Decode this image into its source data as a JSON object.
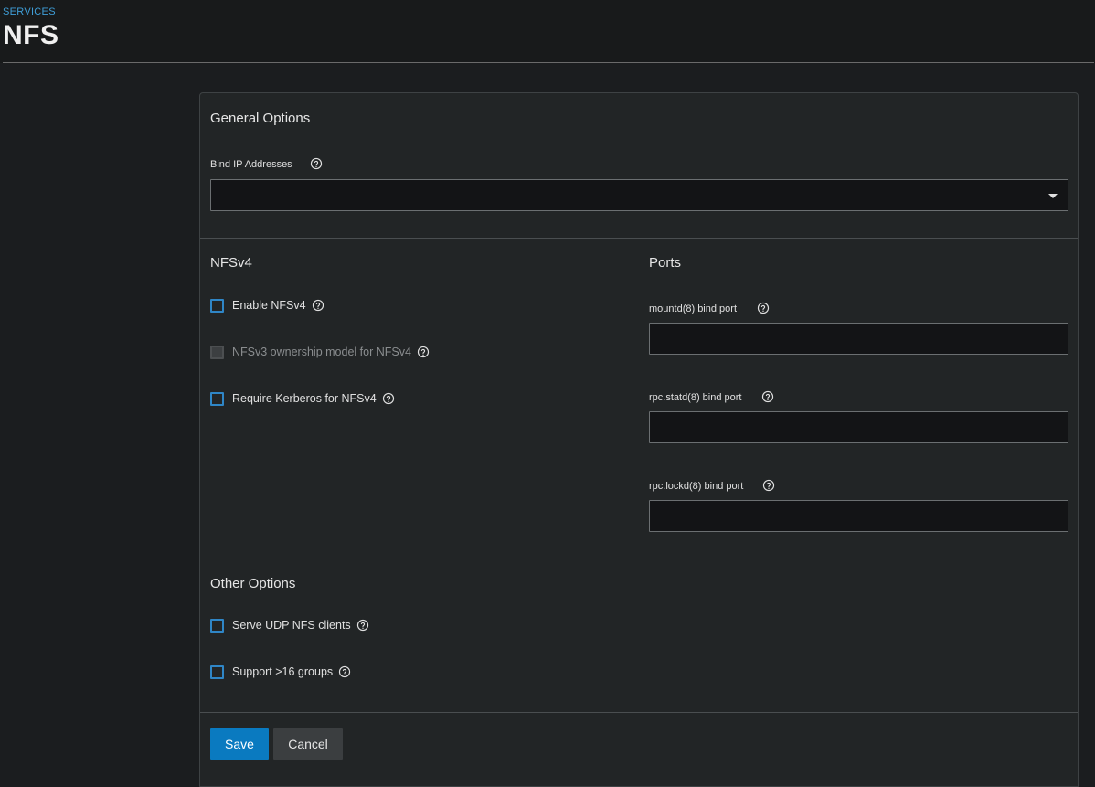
{
  "header": {
    "breadcrumb": "SERVICES",
    "title": "NFS"
  },
  "general": {
    "title": "General Options",
    "bind_ip_label": "Bind IP Addresses",
    "bind_ip_value": ""
  },
  "nfsv4": {
    "title": "NFSv4",
    "enable_label": "Enable NFSv4",
    "ownership_label": "NFSv3 ownership model for NFSv4",
    "kerberos_label": "Require Kerberos for NFSv4"
  },
  "ports": {
    "title": "Ports",
    "mountd_label": "mountd(8) bind port",
    "mountd_value": "",
    "statd_label": "rpc.statd(8) bind port",
    "statd_value": "",
    "lockd_label": "rpc.lockd(8) bind port",
    "lockd_value": ""
  },
  "other": {
    "title": "Other Options",
    "udp_label": "Serve UDP NFS clients",
    "groups_label": "Support >16 groups"
  },
  "actions": {
    "save_label": "Save",
    "cancel_label": "Cancel"
  },
  "colors": {
    "accent": "#0a7ac0",
    "breadcrumb": "#3f9fd9",
    "checkbox_border": "#2f86c6",
    "background": "#1b1d1f",
    "card": "#222526"
  }
}
